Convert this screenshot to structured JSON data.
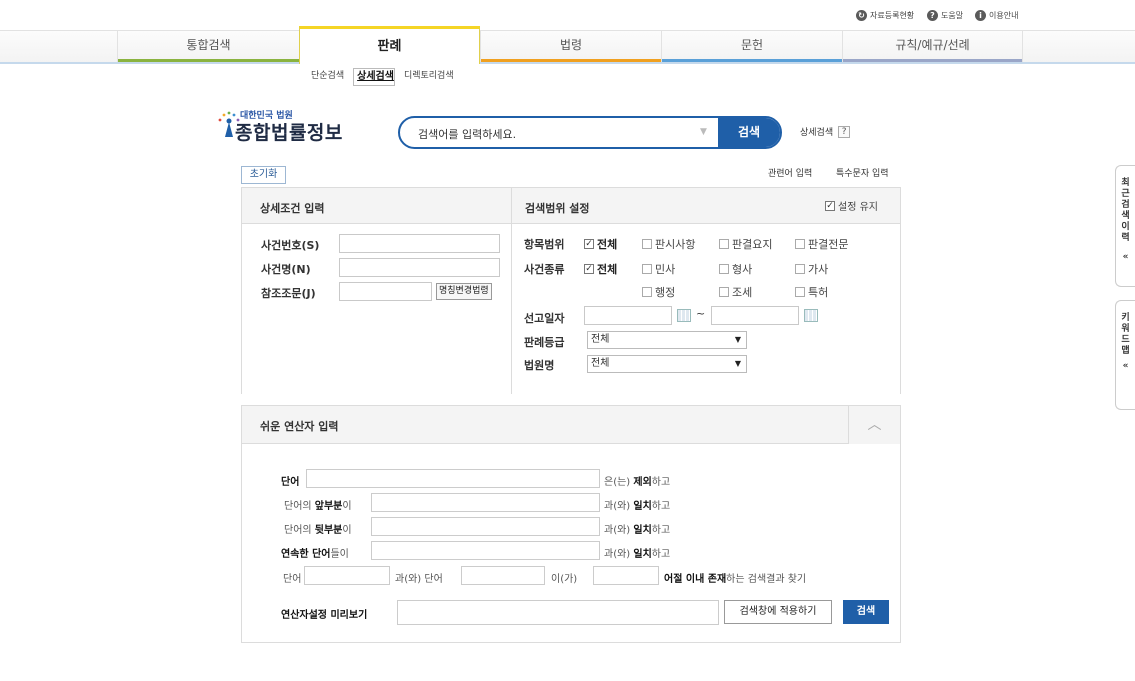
{
  "util_links": [
    {
      "label": "자료등록현황",
      "icon": "document-icon"
    },
    {
      "label": "도움말",
      "icon": "help-icon"
    },
    {
      "label": "이용안내",
      "icon": "info-icon"
    }
  ],
  "tabs": [
    {
      "label": "통합검색",
      "bar": "#8ab33f"
    },
    {
      "label": "판례",
      "bar": "#f5d526"
    },
    {
      "label": "법령",
      "bar": "#f0a020"
    },
    {
      "label": "문헌",
      "bar": "#5aa0d8"
    },
    {
      "label": "규칙/예규/선례",
      "bar": "#9aa6c8"
    }
  ],
  "subnav": [
    "단순검색",
    "상세검색",
    "디렉토리검색"
  ],
  "logo": {
    "small": "대한민국 법원",
    "big": "종합법률정보"
  },
  "search": {
    "placeholder": "검색어를 입력하세요.",
    "button": "검색",
    "advanced": "상세검색",
    "help": "?"
  },
  "reset": "초기화",
  "links": {
    "related": "관련어 입력",
    "special": "특수문자 입력"
  },
  "detail": {
    "title": "상세조건 입력",
    "case_no": "사건번호(S)",
    "case_name": "사건명(N)",
    "ref": "참조조문(J)",
    "ref_button": "명칭변경법령"
  },
  "scope": {
    "title": "검색범위 설정",
    "keep": "설정 유지",
    "item_label": "항목범위",
    "items": [
      "전체",
      "판시사항",
      "판결요지",
      "판결전문"
    ],
    "type_label": "사건종류",
    "types": [
      "전체",
      "민사",
      "형사",
      "가사",
      "행정",
      "조세",
      "특허"
    ],
    "date_label": "선고일자",
    "date_sep": "~",
    "grade_label": "판례등급",
    "grade_value": "전체",
    "court_label": "법원명",
    "court_value": "전체"
  },
  "operator": {
    "title": "쉬운 연산자 입력",
    "row1": {
      "label": "단어",
      "suffix_pre": "은(는) ",
      "suffix_bold": "제외",
      "suffix_post": "하고"
    },
    "row2": {
      "pre": "단어의 ",
      "bold": "앞부분",
      "post": "이",
      "suffix_pre": "과(와) ",
      "suffix_bold": "일치",
      "suffix_post": "하고"
    },
    "row3": {
      "pre": "단어의 ",
      "bold": "뒷부분",
      "post": "이",
      "suffix_pre": "과(와) ",
      "suffix_bold": "일치",
      "suffix_post": "하고"
    },
    "row4": {
      "bold": "연속한 단어",
      "post": "들이",
      "suffix_pre": "과(와) ",
      "suffix_bold": "일치",
      "suffix_post": "하고"
    },
    "row5": {
      "a": "단어",
      "b": "과(와) 단어",
      "c": "이(가)",
      "bold": "어절 이내 존재",
      "post": "하는 검색결과 찾기"
    },
    "preview_label": "연산자설정 미리보기",
    "apply": "검색창에 적용하기",
    "search": "검색"
  },
  "side": {
    "recent": [
      "최",
      "근",
      "검",
      "색",
      "이",
      "력",
      "«"
    ],
    "keyword": [
      "키",
      "워",
      "드",
      "맵",
      "«"
    ]
  }
}
